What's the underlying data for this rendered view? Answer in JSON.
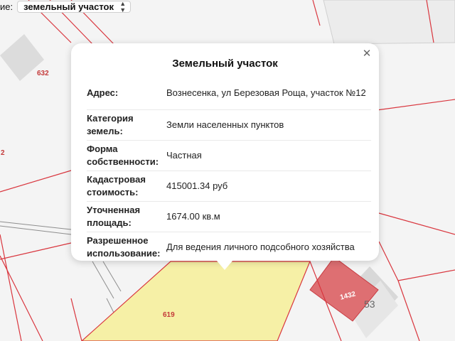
{
  "layer_selector": {
    "label": "ие:",
    "selected": "земельный участок"
  },
  "popup": {
    "title": "Земельный участок",
    "rows": [
      {
        "key": "Адрес:",
        "value": "Вознесенка, ул Березовая Роща, участок №12"
      },
      {
        "key": "Категория земель:",
        "value": "Земли населенных пунктов"
      },
      {
        "key": "Форма собственности:",
        "value": "Частная"
      },
      {
        "key": "Кадастровая стоимость:",
        "value": "415001.34 руб"
      },
      {
        "key": "Уточненная площадь:",
        "value": "1674.00 кв.м"
      },
      {
        "key": "Разрешенное использование:",
        "value": "Для ведения личного подсобного хозяйства"
      }
    ]
  },
  "map": {
    "parcel_labels": [
      "632",
      "2",
      "619",
      "1432",
      "53"
    ],
    "colors": {
      "background": "#f4f4f4",
      "boundary": "#d9363e",
      "selected_parcel": "#f6f0a6",
      "highlight_parcel": "#de6f72",
      "building": "#dddddd"
    }
  }
}
